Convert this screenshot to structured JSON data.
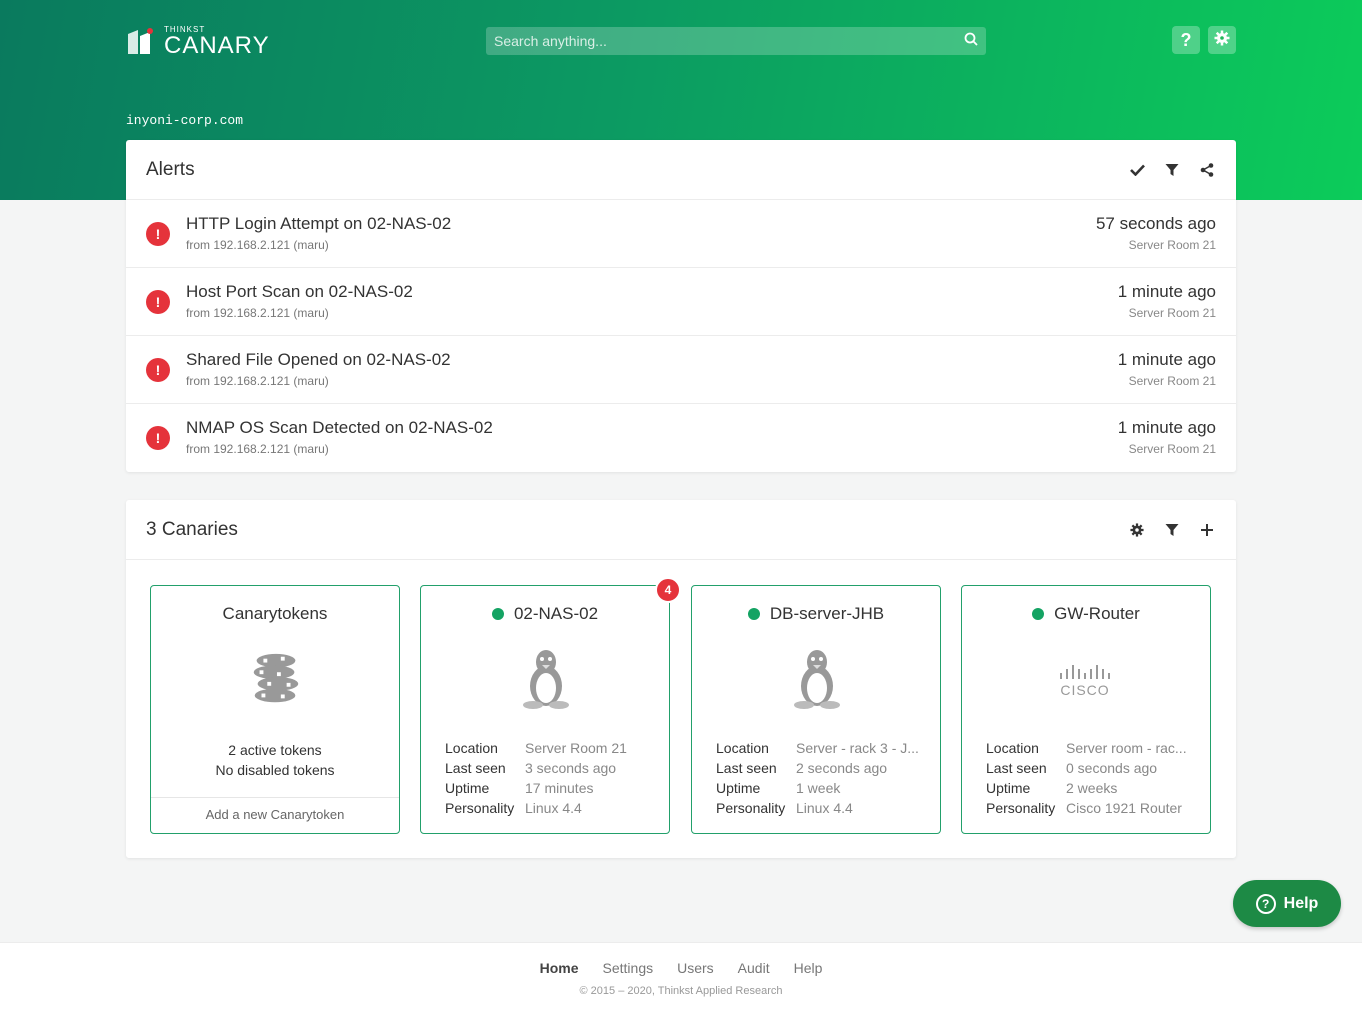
{
  "header": {
    "logo_small": "THINKST",
    "logo_big": "CANARY",
    "search_placeholder": "Search anything...",
    "help_label": "?",
    "domain": "inyoni-corp.com"
  },
  "alerts": {
    "title": "Alerts",
    "items": [
      {
        "title": "HTTP Login Attempt on 02-NAS-02",
        "source": "from 192.168.2.121 (maru)",
        "time": "57 seconds ago",
        "location": "Server Room 21"
      },
      {
        "title": "Host Port Scan on 02-NAS-02",
        "source": "from 192.168.2.121 (maru)",
        "time": "1 minute ago",
        "location": "Server Room 21"
      },
      {
        "title": "Shared File Opened on 02-NAS-02",
        "source": "from 192.168.2.121 (maru)",
        "time": "1 minute ago",
        "location": "Server Room 21"
      },
      {
        "title": "NMAP OS Scan Detected on 02-NAS-02",
        "source": "from 192.168.2.121 (maru)",
        "time": "1 minute ago",
        "location": "Server Room 21"
      }
    ]
  },
  "canaries": {
    "title": "3 Canaries",
    "tokens": {
      "title": "Canarytokens",
      "active": "2 active tokens",
      "disabled": "No disabled tokens",
      "add_label": "Add a new Canarytoken"
    },
    "labels": {
      "location": "Location",
      "last_seen": "Last seen",
      "uptime": "Uptime",
      "personality": "Personality"
    },
    "devices": [
      {
        "name": "02-NAS-02",
        "alert_count": "4",
        "location": "Server Room 21",
        "last_seen": "3 seconds ago",
        "uptime": "17 minutes",
        "personality": "Linux 4.4",
        "icon": "linux-penguin-icon"
      },
      {
        "name": "DB-server-JHB",
        "location": "Server - rack 3 - J...",
        "last_seen": "2 seconds ago",
        "uptime": "1 week",
        "personality": "Linux 4.4",
        "icon": "linux-penguin-icon"
      },
      {
        "name": "GW-Router",
        "location": "Server room - rac...",
        "last_seen": "0 seconds ago",
        "uptime": "2 weeks",
        "personality": "Cisco 1921 Router",
        "icon": "cisco-logo-icon",
        "logo_text": "CISCO"
      }
    ],
    "status_color": "#14a363"
  },
  "help_button": {
    "label": "Help"
  },
  "footer": {
    "nav": [
      "Home",
      "Settings",
      "Users",
      "Audit",
      "Help"
    ],
    "copyright": "© 2015 – 2020, Thinkst Applied Research"
  },
  "colors": {
    "alert_red": "#e5333b",
    "brand_green": "#14a363"
  }
}
